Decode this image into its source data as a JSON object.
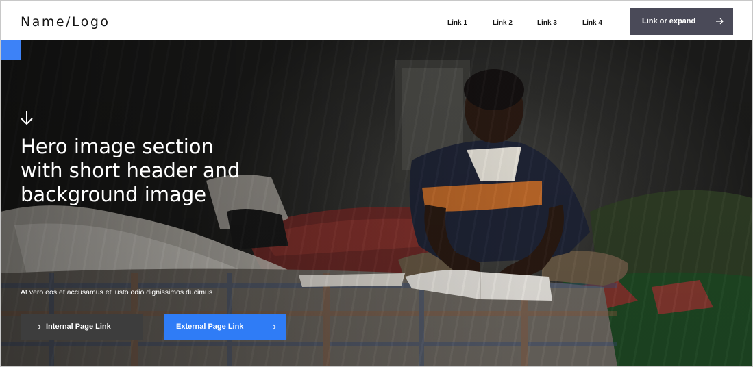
{
  "header": {
    "logo": "Name/Logo",
    "nav": [
      {
        "label": "Link 1",
        "active": true
      },
      {
        "label": "Link 2"
      },
      {
        "label": "Link 3"
      },
      {
        "label": "Link 4"
      }
    ],
    "cta": {
      "label": "Link or expand",
      "icon": "arrow-right-icon"
    }
  },
  "hero": {
    "headline": "Hero image section\nwith short header and\nbackground image",
    "subtext": "At vero eos et accusamus et iusto odio dignissimos ducimus",
    "buttons": {
      "internal": {
        "label": "Internal Page Link",
        "icon": "arrow-right-icon"
      },
      "external": {
        "label": "External Page Link",
        "icon": "arrow-right-icon"
      }
    },
    "icons": {
      "scroll": "arrow-down-icon"
    }
  },
  "colors": {
    "accent": "#3d82f7",
    "primary_button": "#2f7cf6",
    "secondary_button": "#3d3d3d",
    "cta_background": "#4a4a58",
    "header_background": "#ffffff",
    "text_dark": "#161616"
  }
}
